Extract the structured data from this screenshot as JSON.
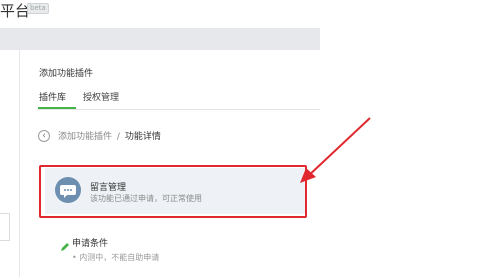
{
  "header": {
    "platform_title": "平台",
    "badge": "beta"
  },
  "page": {
    "title": "添加功能插件"
  },
  "tabs": [
    {
      "label": "插件库",
      "active": true
    },
    {
      "label": "授权管理",
      "active": false
    }
  ],
  "breadcrumb": {
    "back_link": "添加功能插件",
    "separator": "/",
    "current": "功能详情"
  },
  "plugin": {
    "name": "留言管理",
    "status": "该功能已通过申请，可正常使用",
    "icon": "speech-bubble-icon"
  },
  "conditions": {
    "title": "申请条件",
    "items": [
      "内测中，不能自助申请"
    ]
  },
  "colors": {
    "accent": "#44b549",
    "highlight": "#e0282e",
    "card_bg": "#eef2f6",
    "icon_bg": "#6d8fb0"
  }
}
